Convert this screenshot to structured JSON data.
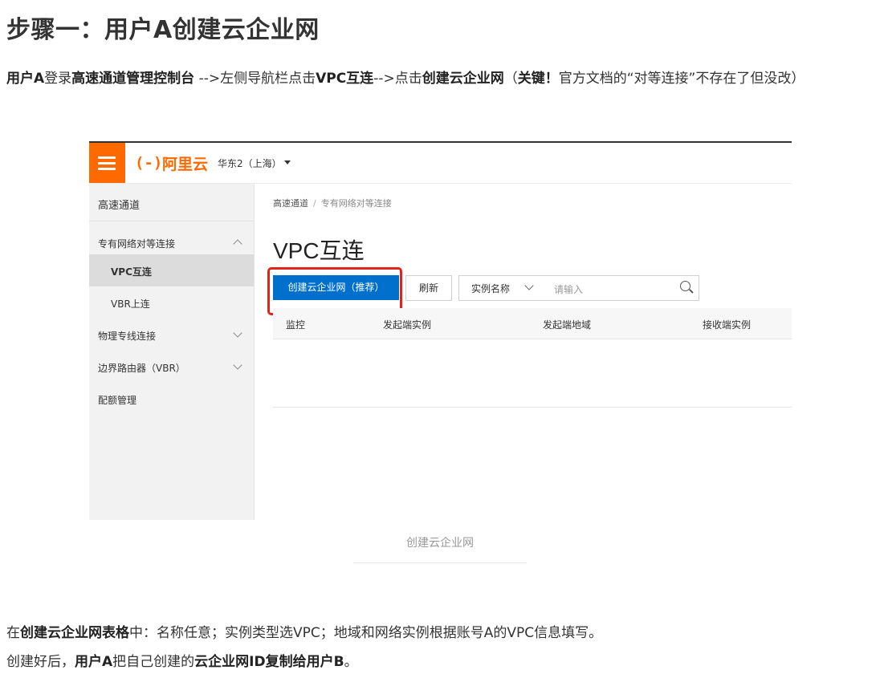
{
  "heading": "步骤一：用户A创建云企业网",
  "intro": {
    "s1": "用户A",
    "s2": "登录",
    "s3": "高速通道管理控制台",
    "s4": " -->左侧导航栏点击",
    "s5": "VPC互连",
    "s6": "-->点击",
    "s7": "创建云企业网",
    "s8": "（",
    "s9": "关键！",
    "s10": "官方文档的“对等连接”不存在了但没改）"
  },
  "console": {
    "logo_mark": "(-)",
    "logo_text": "阿里云",
    "region": "华东2（上海）",
    "sidebar": {
      "title": "高速通道",
      "items": [
        {
          "label": "专有网络对等连接"
        },
        {
          "label": "VPC互连"
        },
        {
          "label": "VBR上连"
        },
        {
          "label": "物理专线连接"
        },
        {
          "label": "边界路由器（VBR）"
        },
        {
          "label": "配额管理"
        }
      ]
    },
    "breadcrumb": {
      "root": "高速通道",
      "sep": "/",
      "current": "专有网络对等连接"
    },
    "page_title": "VPC互连",
    "create_button": "创建云企业网（推荐）",
    "refresh_button": "刷新",
    "filter_select": "实例名称",
    "search_placeholder": "请输入",
    "table_headers": [
      "监控",
      "发起端实例",
      "发起端地域",
      "接收端实例"
    ],
    "accent_color": "#ff6a00",
    "primary_color": "#0070cc"
  },
  "caption": "创建云企业网",
  "after": {
    "a1": "在",
    "a2": "创建云企业网表格",
    "a3": "中：名称任意；实例类型选VPC；地域和网络实例根据账号A的VPC信息填写。",
    "b1": "创建好后，",
    "b2": "用户A",
    "b3": "把自己创建的",
    "b4": "云企业网",
    "b5": "ID复制给",
    "b6": "用户B",
    "b7": "。"
  }
}
